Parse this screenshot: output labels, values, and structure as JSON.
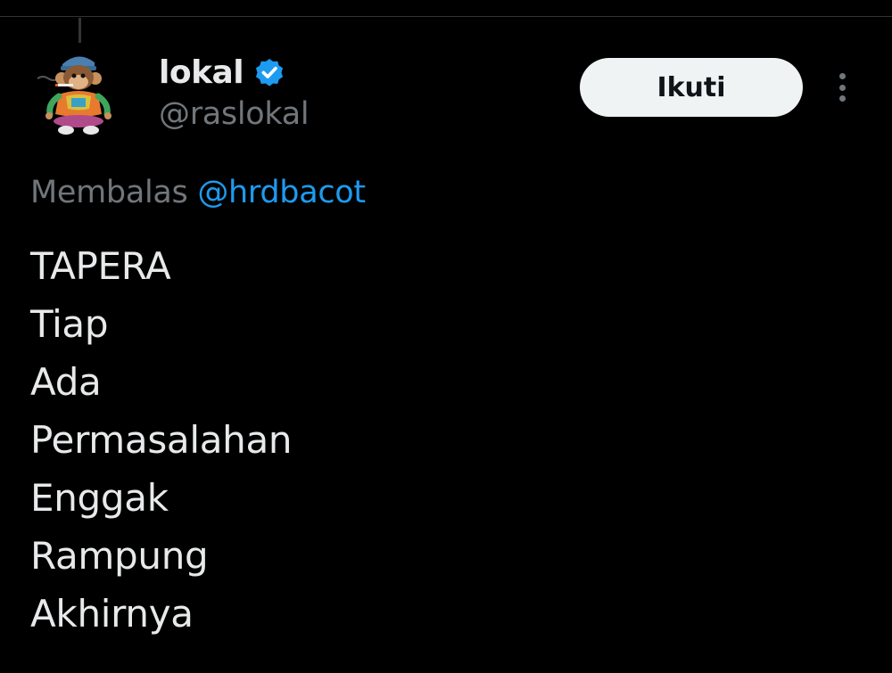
{
  "tweet": {
    "author": {
      "display_name": "lokal",
      "handle": "@raslokal",
      "verified": true,
      "avatar": "monkey-cartoon-avatar"
    },
    "follow_label": "Ikuti",
    "more_icon": "more-vertical-icon",
    "reply_context": {
      "prefix": "Membalas",
      "mention": "@hrdbacot"
    },
    "lines": [
      "TAPERA",
      "Tiap",
      "Ada",
      "Permasalahan",
      "Enggak",
      "Rampung",
      "Akhirnya"
    ]
  },
  "colors": {
    "background": "#000000",
    "text_primary": "#e7e9ea",
    "text_secondary": "#71767b",
    "accent": "#1d9bf0",
    "button_bg": "#eff3f4",
    "button_text": "#0f1419"
  }
}
